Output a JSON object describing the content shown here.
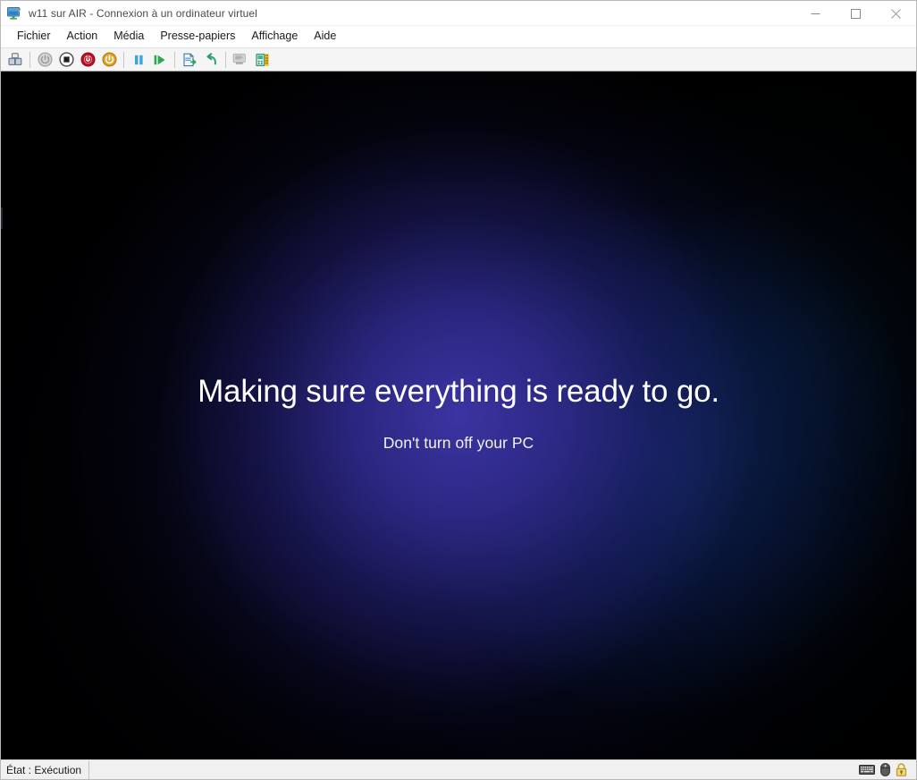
{
  "window": {
    "title": "w11 sur AIR - Connexion à un ordinateur virtuel",
    "icon": "virtual-machine-monitor-icon",
    "controls": {
      "minimize": "Réduire",
      "maximize": "Agrandir",
      "close": "Fermer"
    }
  },
  "menubar": {
    "items": [
      {
        "label": "Fichier",
        "name": "menu-fichier"
      },
      {
        "label": "Action",
        "name": "menu-action"
      },
      {
        "label": "Média",
        "name": "menu-media"
      },
      {
        "label": "Presse-papiers",
        "name": "menu-presse-papiers"
      },
      {
        "label": "Affichage",
        "name": "menu-affichage"
      },
      {
        "label": "Aide",
        "name": "menu-aide"
      }
    ]
  },
  "toolbar": {
    "buttons": [
      {
        "name": "ctrl-alt-del-button",
        "icon": "keyboard-ctrl-alt-del-icon",
        "enabled": true
      },
      {
        "name": "start-button",
        "icon": "power-start-icon",
        "enabled": false
      },
      {
        "name": "turn-off-button",
        "icon": "stop-square-icon",
        "enabled": true
      },
      {
        "name": "shut-down-button",
        "icon": "power-shutdown-icon",
        "enabled": true
      },
      {
        "name": "save-button",
        "icon": "power-save-amber-icon",
        "enabled": true
      },
      {
        "name": "pause-button",
        "icon": "pause-icon",
        "enabled": true
      },
      {
        "name": "reset-button",
        "icon": "play-reset-icon",
        "enabled": true
      },
      {
        "name": "checkpoint-button",
        "icon": "checkpoint-icon",
        "enabled": true
      },
      {
        "name": "revert-button",
        "icon": "revert-arrow-icon",
        "enabled": true
      },
      {
        "name": "enhanced-session-button",
        "icon": "enhanced-session-icon",
        "enabled": false
      },
      {
        "name": "share-button",
        "icon": "share-vm-icon",
        "enabled": true
      }
    ]
  },
  "vm_screen": {
    "oobe": {
      "title": "Making sure everything is ready to go.",
      "subtitle": "Don't turn off your PC"
    },
    "colors": {
      "background": "#000000",
      "glow_purple": "#3e36a8",
      "glow_blue": "#10306e",
      "text": "#ffffff"
    }
  },
  "statusbar": {
    "state_label": "État : Exécution",
    "icons": [
      {
        "name": "keyboard-capture-icon",
        "title": "Entrée clavier"
      },
      {
        "name": "mouse-capture-icon",
        "title": "Entrée souris"
      },
      {
        "name": "lock-icon",
        "title": "Verrouillé"
      }
    ]
  }
}
